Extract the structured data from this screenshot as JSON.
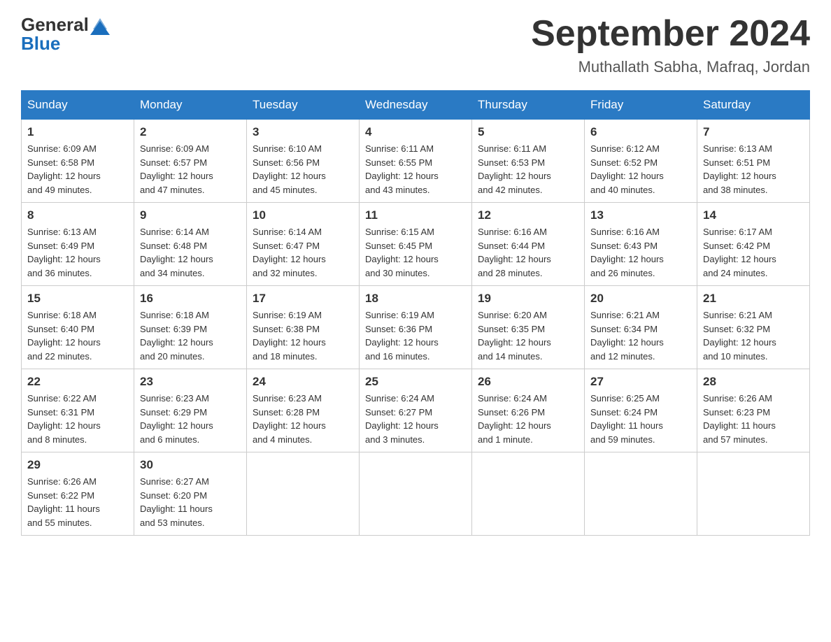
{
  "header": {
    "logo_general": "General",
    "logo_blue": "Blue",
    "title": "September 2024",
    "subtitle": "Muthallath Sabha, Mafraq, Jordan"
  },
  "days_of_week": [
    "Sunday",
    "Monday",
    "Tuesday",
    "Wednesday",
    "Thursday",
    "Friday",
    "Saturday"
  ],
  "weeks": [
    [
      {
        "day": "1",
        "sunrise": "6:09 AM",
        "sunset": "6:58 PM",
        "daylight": "12 hours and 49 minutes."
      },
      {
        "day": "2",
        "sunrise": "6:09 AM",
        "sunset": "6:57 PM",
        "daylight": "12 hours and 47 minutes."
      },
      {
        "day": "3",
        "sunrise": "6:10 AM",
        "sunset": "6:56 PM",
        "daylight": "12 hours and 45 minutes."
      },
      {
        "day": "4",
        "sunrise": "6:11 AM",
        "sunset": "6:55 PM",
        "daylight": "12 hours and 43 minutes."
      },
      {
        "day": "5",
        "sunrise": "6:11 AM",
        "sunset": "6:53 PM",
        "daylight": "12 hours and 42 minutes."
      },
      {
        "day": "6",
        "sunrise": "6:12 AM",
        "sunset": "6:52 PM",
        "daylight": "12 hours and 40 minutes."
      },
      {
        "day": "7",
        "sunrise": "6:13 AM",
        "sunset": "6:51 PM",
        "daylight": "12 hours and 38 minutes."
      }
    ],
    [
      {
        "day": "8",
        "sunrise": "6:13 AM",
        "sunset": "6:49 PM",
        "daylight": "12 hours and 36 minutes."
      },
      {
        "day": "9",
        "sunrise": "6:14 AM",
        "sunset": "6:48 PM",
        "daylight": "12 hours and 34 minutes."
      },
      {
        "day": "10",
        "sunrise": "6:14 AM",
        "sunset": "6:47 PM",
        "daylight": "12 hours and 32 minutes."
      },
      {
        "day": "11",
        "sunrise": "6:15 AM",
        "sunset": "6:45 PM",
        "daylight": "12 hours and 30 minutes."
      },
      {
        "day": "12",
        "sunrise": "6:16 AM",
        "sunset": "6:44 PM",
        "daylight": "12 hours and 28 minutes."
      },
      {
        "day": "13",
        "sunrise": "6:16 AM",
        "sunset": "6:43 PM",
        "daylight": "12 hours and 26 minutes."
      },
      {
        "day": "14",
        "sunrise": "6:17 AM",
        "sunset": "6:42 PM",
        "daylight": "12 hours and 24 minutes."
      }
    ],
    [
      {
        "day": "15",
        "sunrise": "6:18 AM",
        "sunset": "6:40 PM",
        "daylight": "12 hours and 22 minutes."
      },
      {
        "day": "16",
        "sunrise": "6:18 AM",
        "sunset": "6:39 PM",
        "daylight": "12 hours and 20 minutes."
      },
      {
        "day": "17",
        "sunrise": "6:19 AM",
        "sunset": "6:38 PM",
        "daylight": "12 hours and 18 minutes."
      },
      {
        "day": "18",
        "sunrise": "6:19 AM",
        "sunset": "6:36 PM",
        "daylight": "12 hours and 16 minutes."
      },
      {
        "day": "19",
        "sunrise": "6:20 AM",
        "sunset": "6:35 PM",
        "daylight": "12 hours and 14 minutes."
      },
      {
        "day": "20",
        "sunrise": "6:21 AM",
        "sunset": "6:34 PM",
        "daylight": "12 hours and 12 minutes."
      },
      {
        "day": "21",
        "sunrise": "6:21 AM",
        "sunset": "6:32 PM",
        "daylight": "12 hours and 10 minutes."
      }
    ],
    [
      {
        "day": "22",
        "sunrise": "6:22 AM",
        "sunset": "6:31 PM",
        "daylight": "12 hours and 8 minutes."
      },
      {
        "day": "23",
        "sunrise": "6:23 AM",
        "sunset": "6:29 PM",
        "daylight": "12 hours and 6 minutes."
      },
      {
        "day": "24",
        "sunrise": "6:23 AM",
        "sunset": "6:28 PM",
        "daylight": "12 hours and 4 minutes."
      },
      {
        "day": "25",
        "sunrise": "6:24 AM",
        "sunset": "6:27 PM",
        "daylight": "12 hours and 3 minutes."
      },
      {
        "day": "26",
        "sunrise": "6:24 AM",
        "sunset": "6:26 PM",
        "daylight": "12 hours and 1 minute."
      },
      {
        "day": "27",
        "sunrise": "6:25 AM",
        "sunset": "6:24 PM",
        "daylight": "11 hours and 59 minutes."
      },
      {
        "day": "28",
        "sunrise": "6:26 AM",
        "sunset": "6:23 PM",
        "daylight": "11 hours and 57 minutes."
      }
    ],
    [
      {
        "day": "29",
        "sunrise": "6:26 AM",
        "sunset": "6:22 PM",
        "daylight": "11 hours and 55 minutes."
      },
      {
        "day": "30",
        "sunrise": "6:27 AM",
        "sunset": "6:20 PM",
        "daylight": "11 hours and 53 minutes."
      },
      null,
      null,
      null,
      null,
      null
    ]
  ],
  "labels": {
    "sunrise": "Sunrise:",
    "sunset": "Sunset:",
    "daylight": "Daylight:"
  }
}
